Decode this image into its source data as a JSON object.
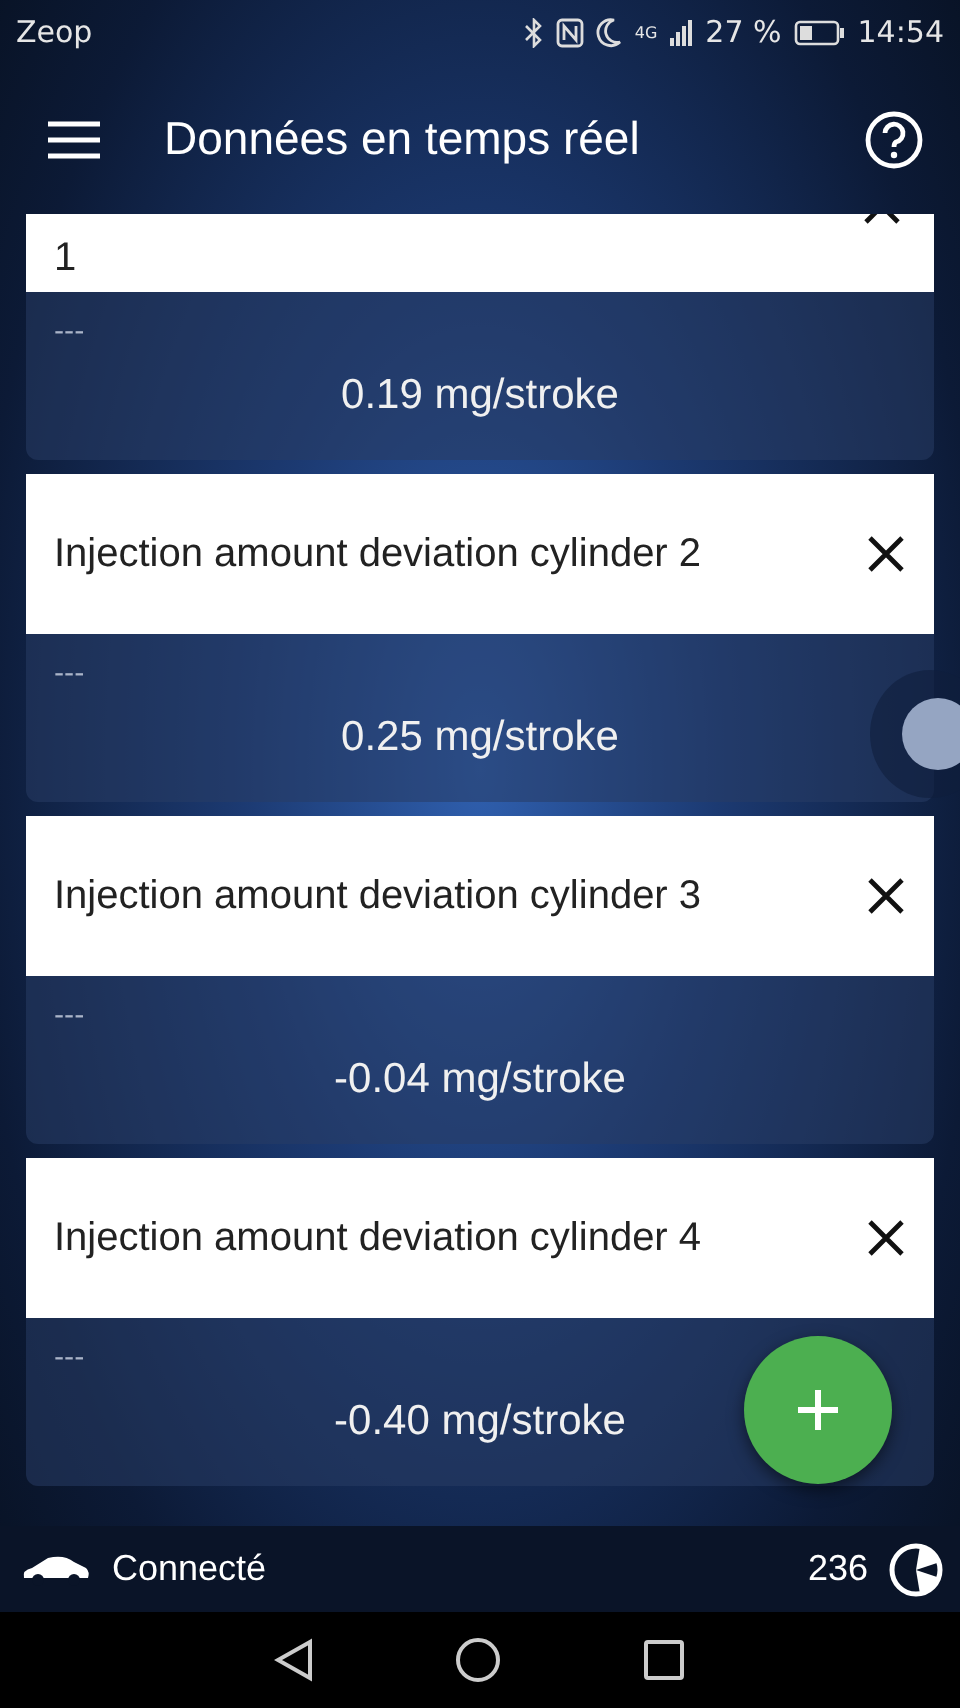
{
  "status_bar": {
    "carrier": "Zeop",
    "network": "4G",
    "battery": "27 %",
    "time": "14:54"
  },
  "app_bar": {
    "title": "Données en temps réel"
  },
  "cards": [
    {
      "title": "1",
      "placeholder": "---",
      "value": "0.19 mg/stroke"
    },
    {
      "title": "Injection amount deviation cylinder 2",
      "placeholder": "---",
      "value": "0.25 mg/stroke"
    },
    {
      "title": "Injection amount deviation cylinder 3",
      "placeholder": "---",
      "value": "-0.04 mg/stroke"
    },
    {
      "title": "Injection amount deviation cylinder 4",
      "placeholder": "---",
      "value": "-0.40 mg/stroke"
    }
  ],
  "footer": {
    "status": "Connecté",
    "count": "236"
  }
}
